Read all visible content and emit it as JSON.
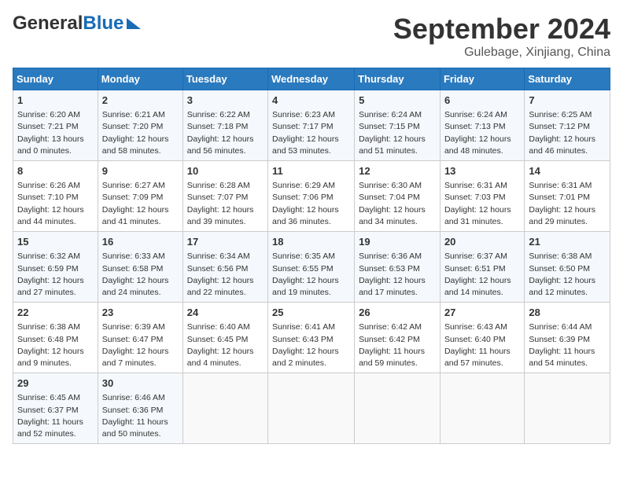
{
  "header": {
    "logo_line1": "General",
    "logo_line2": "Blue",
    "title": "September 2024",
    "location": "Gulebage, Xinjiang, China"
  },
  "columns": [
    "Sunday",
    "Monday",
    "Tuesday",
    "Wednesday",
    "Thursday",
    "Friday",
    "Saturday"
  ],
  "weeks": [
    [
      {
        "day": "1",
        "info": "Sunrise: 6:20 AM\nSunset: 7:21 PM\nDaylight: 13 hours\nand 0 minutes."
      },
      {
        "day": "2",
        "info": "Sunrise: 6:21 AM\nSunset: 7:20 PM\nDaylight: 12 hours\nand 58 minutes."
      },
      {
        "day": "3",
        "info": "Sunrise: 6:22 AM\nSunset: 7:18 PM\nDaylight: 12 hours\nand 56 minutes."
      },
      {
        "day": "4",
        "info": "Sunrise: 6:23 AM\nSunset: 7:17 PM\nDaylight: 12 hours\nand 53 minutes."
      },
      {
        "day": "5",
        "info": "Sunrise: 6:24 AM\nSunset: 7:15 PM\nDaylight: 12 hours\nand 51 minutes."
      },
      {
        "day": "6",
        "info": "Sunrise: 6:24 AM\nSunset: 7:13 PM\nDaylight: 12 hours\nand 48 minutes."
      },
      {
        "day": "7",
        "info": "Sunrise: 6:25 AM\nSunset: 7:12 PM\nDaylight: 12 hours\nand 46 minutes."
      }
    ],
    [
      {
        "day": "8",
        "info": "Sunrise: 6:26 AM\nSunset: 7:10 PM\nDaylight: 12 hours\nand 44 minutes."
      },
      {
        "day": "9",
        "info": "Sunrise: 6:27 AM\nSunset: 7:09 PM\nDaylight: 12 hours\nand 41 minutes."
      },
      {
        "day": "10",
        "info": "Sunrise: 6:28 AM\nSunset: 7:07 PM\nDaylight: 12 hours\nand 39 minutes."
      },
      {
        "day": "11",
        "info": "Sunrise: 6:29 AM\nSunset: 7:06 PM\nDaylight: 12 hours\nand 36 minutes."
      },
      {
        "day": "12",
        "info": "Sunrise: 6:30 AM\nSunset: 7:04 PM\nDaylight: 12 hours\nand 34 minutes."
      },
      {
        "day": "13",
        "info": "Sunrise: 6:31 AM\nSunset: 7:03 PM\nDaylight: 12 hours\nand 31 minutes."
      },
      {
        "day": "14",
        "info": "Sunrise: 6:31 AM\nSunset: 7:01 PM\nDaylight: 12 hours\nand 29 minutes."
      }
    ],
    [
      {
        "day": "15",
        "info": "Sunrise: 6:32 AM\nSunset: 6:59 PM\nDaylight: 12 hours\nand 27 minutes."
      },
      {
        "day": "16",
        "info": "Sunrise: 6:33 AM\nSunset: 6:58 PM\nDaylight: 12 hours\nand 24 minutes."
      },
      {
        "day": "17",
        "info": "Sunrise: 6:34 AM\nSunset: 6:56 PM\nDaylight: 12 hours\nand 22 minutes."
      },
      {
        "day": "18",
        "info": "Sunrise: 6:35 AM\nSunset: 6:55 PM\nDaylight: 12 hours\nand 19 minutes."
      },
      {
        "day": "19",
        "info": "Sunrise: 6:36 AM\nSunset: 6:53 PM\nDaylight: 12 hours\nand 17 minutes."
      },
      {
        "day": "20",
        "info": "Sunrise: 6:37 AM\nSunset: 6:51 PM\nDaylight: 12 hours\nand 14 minutes."
      },
      {
        "day": "21",
        "info": "Sunrise: 6:38 AM\nSunset: 6:50 PM\nDaylight: 12 hours\nand 12 minutes."
      }
    ],
    [
      {
        "day": "22",
        "info": "Sunrise: 6:38 AM\nSunset: 6:48 PM\nDaylight: 12 hours\nand 9 minutes."
      },
      {
        "day": "23",
        "info": "Sunrise: 6:39 AM\nSunset: 6:47 PM\nDaylight: 12 hours\nand 7 minutes."
      },
      {
        "day": "24",
        "info": "Sunrise: 6:40 AM\nSunset: 6:45 PM\nDaylight: 12 hours\nand 4 minutes."
      },
      {
        "day": "25",
        "info": "Sunrise: 6:41 AM\nSunset: 6:43 PM\nDaylight: 12 hours\nand 2 minutes."
      },
      {
        "day": "26",
        "info": "Sunrise: 6:42 AM\nSunset: 6:42 PM\nDaylight: 11 hours\nand 59 minutes."
      },
      {
        "day": "27",
        "info": "Sunrise: 6:43 AM\nSunset: 6:40 PM\nDaylight: 11 hours\nand 57 minutes."
      },
      {
        "day": "28",
        "info": "Sunrise: 6:44 AM\nSunset: 6:39 PM\nDaylight: 11 hours\nand 54 minutes."
      }
    ],
    [
      {
        "day": "29",
        "info": "Sunrise: 6:45 AM\nSunset: 6:37 PM\nDaylight: 11 hours\nand 52 minutes."
      },
      {
        "day": "30",
        "info": "Sunrise: 6:46 AM\nSunset: 6:36 PM\nDaylight: 11 hours\nand 50 minutes."
      },
      {
        "day": "",
        "info": ""
      },
      {
        "day": "",
        "info": ""
      },
      {
        "day": "",
        "info": ""
      },
      {
        "day": "",
        "info": ""
      },
      {
        "day": "",
        "info": ""
      }
    ]
  ]
}
